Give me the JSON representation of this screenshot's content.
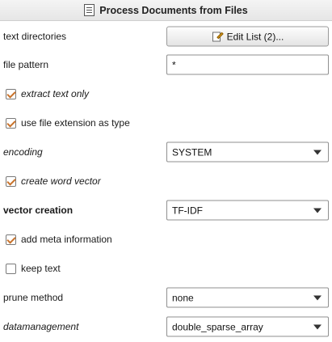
{
  "header": {
    "title": "Process Documents from Files",
    "icon": "document-icon"
  },
  "params": {
    "text_directories": {
      "label": "text directories",
      "button": "Edit List (2)..."
    },
    "file_pattern": {
      "label": "file pattern",
      "value": "*"
    },
    "extract_text_only": {
      "label": "extract text only",
      "checked": true
    },
    "use_file_extension": {
      "label": "use file extension as type",
      "checked": true
    },
    "encoding": {
      "label": "encoding",
      "value": "SYSTEM"
    },
    "create_word_vector": {
      "label": "create word vector",
      "checked": true
    },
    "vector_creation": {
      "label": "vector creation",
      "value": "TF-IDF"
    },
    "add_meta_information": {
      "label": "add meta information",
      "checked": true
    },
    "keep_text": {
      "label": "keep text",
      "checked": false
    },
    "prune_method": {
      "label": "prune method",
      "value": "none"
    },
    "datamanagement": {
      "label": "datamanagement",
      "value": "double_sparse_array"
    }
  },
  "colors": {
    "checkmark": "#c8722b",
    "header_bg": "#eeeeee",
    "border": "#8f8f8f"
  }
}
